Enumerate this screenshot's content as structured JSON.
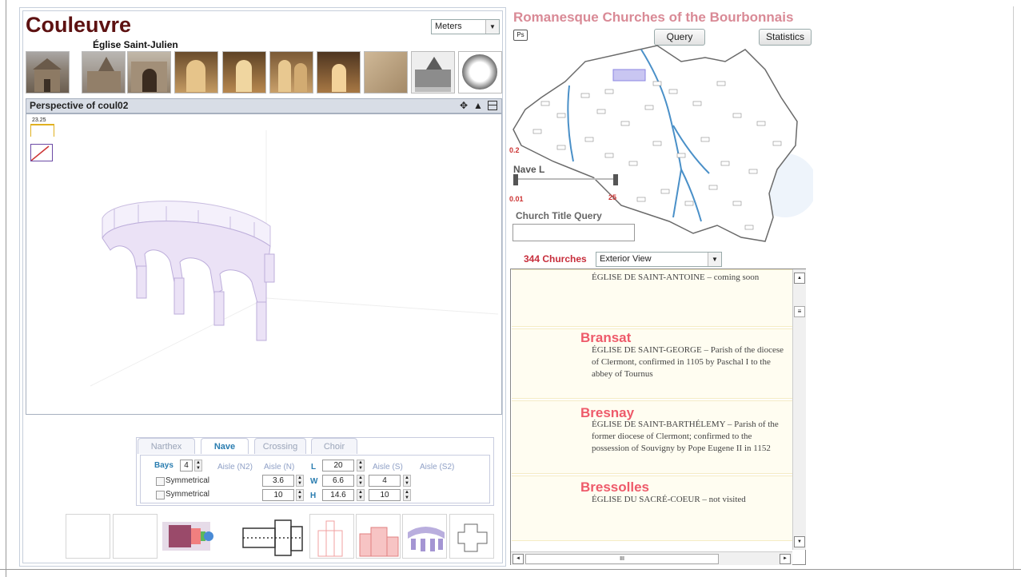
{
  "app": {
    "church_name": "Couleuvre",
    "church_subtitle": "Église Saint-Julien",
    "units_select": "Meters"
  },
  "perspective": {
    "title": "Perspective of coul02",
    "scale_value": "23.25",
    "icons": [
      "move-icon",
      "mountain-icon",
      "window-icon"
    ]
  },
  "editor": {
    "tabs": [
      "Narthex",
      "Nave",
      "Crossing",
      "Choir"
    ],
    "active_tab": "Nave",
    "bays_label": "Bays",
    "bays_value": "4",
    "col_aisle_n2": "Aisle (N2)",
    "col_aisle_n": "Aisle (N)",
    "col_aisle_s": "Aisle (S)",
    "col_aisle_s2": "Aisle (S2)",
    "row_l": "L",
    "row_w": "W",
    "row_h": "H",
    "symmetrical_1": "Symmetrical",
    "symmetrical_2": "Symmetrical",
    "l_value": "20",
    "w_aisle_n": "3.6",
    "w_value": "6.6",
    "w_aisle_s": "4",
    "h_aisle_n": "10",
    "h_value": "14.6",
    "h_aisle_s": "10"
  },
  "map_panel": {
    "title": "Romanesque Churches of the Bourbonnais",
    "ps_button": "Ps",
    "query_button": "Query",
    "statistics_button": "Statistics",
    "nave_label": "Nave L",
    "slider_min": "0.01",
    "slider_max": "25",
    "edge_label": "0.2",
    "church_title_query_label": "Church Title Query",
    "church_title_query_value": "",
    "churches_count": "344 Churches",
    "view_select": "Exterior View"
  },
  "church_list": [
    {
      "title": "",
      "text": "ÉGLISE DE SAINT-ANTOINE – coming soon"
    },
    {
      "title": "Bransat",
      "text": "ÉGLISE DE SAINT-GEORGE – Parish of the diocese of Clermont, confirmed in 1105 by Paschal I to the abbey of Tournus"
    },
    {
      "title": "Bresnay",
      "text": "ÉGLISE DE SAINT-BARTHÉLEMY – Parish of the former diocese of Clermont; confirmed to the possession of Souvigny by Pope Eugene II in 1152"
    },
    {
      "title": "Bressolles",
      "text": "ÉGLISE DU SACRÉ-COEUR – not visited"
    }
  ],
  "scrollbar": {
    "horizontal_thumb": "III",
    "vertical_thumb": "≡"
  },
  "colors": {
    "title": "#5d1111",
    "accent": "#2a7db0",
    "list_title": "#ee5a6a",
    "map_title": "#d98a96",
    "river": "#4a90c8"
  }
}
